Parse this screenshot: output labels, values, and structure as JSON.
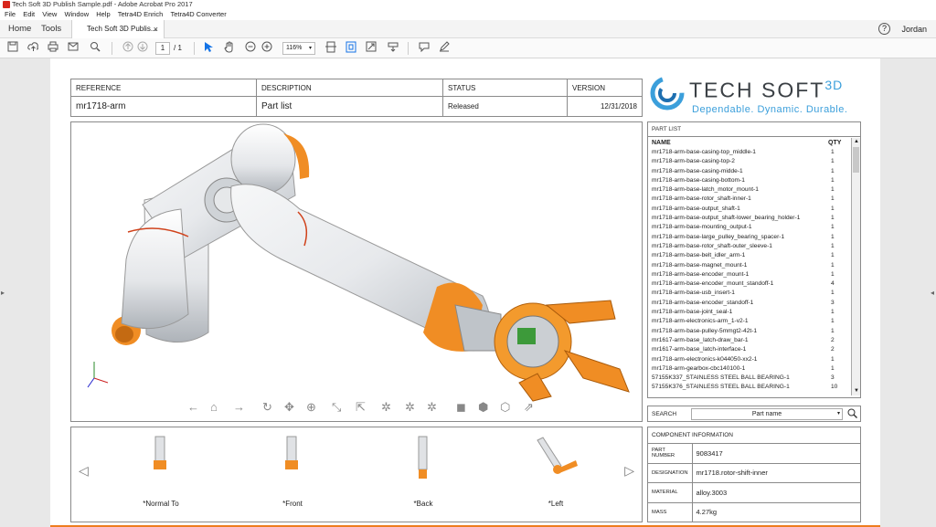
{
  "window": {
    "title": "Tech Soft 3D Publish Sample.pdf - Adobe Acrobat Pro 2017"
  },
  "menu": [
    "File",
    "Edit",
    "View",
    "Window",
    "Help",
    "Tetra4D Enrich",
    "Tetra4D Converter"
  ],
  "nav": {
    "home": "Home",
    "tools": "Tools",
    "doc_tab": "Tech Soft 3D Publis...",
    "close": "×",
    "help": "?",
    "user": "Jordan"
  },
  "toolbar": {
    "page_current": "1",
    "page_total": "/ 1",
    "zoom": "116%",
    "zoom_arrow": "▾"
  },
  "reference": {
    "headers": [
      "REFERENCE",
      "DESCRIPTION",
      "STATUS",
      "VERSION"
    ],
    "values": [
      "mr1718-arm",
      "Part list",
      "Released",
      "12/31/2018"
    ]
  },
  "logo": {
    "name": "TECH SOFT",
    "sup": "3D",
    "tagline": "Dependable. Dynamic. Durable."
  },
  "part_list": {
    "title": "PART LIST",
    "col_name": "NAME",
    "col_qty": "QTY",
    "rows": [
      {
        "name": "mr1718-arm-base-casing-top_middle-1",
        "qty": "1"
      },
      {
        "name": "mr1718-arm-base-casing-top-2",
        "qty": "1"
      },
      {
        "name": "mr1718-arm-base-casing-midde-1",
        "qty": "1"
      },
      {
        "name": "mr1718-arm-base-casing-bottom-1",
        "qty": "1"
      },
      {
        "name": "mr1718-arm-base-latch_motor_mount-1",
        "qty": "1"
      },
      {
        "name": "mr1718-arm-base-rotor_shaft-inner-1",
        "qty": "1"
      },
      {
        "name": "mr1718-arm-base-output_shaft-1",
        "qty": "1"
      },
      {
        "name": "mr1718-arm-base-output_shaft-lower_bearing_holder-1",
        "qty": "1"
      },
      {
        "name": "mr1718-arm-base-mounting_output-1",
        "qty": "1"
      },
      {
        "name": "mr1718-arm-base-large_pulley_bearing_spacer-1",
        "qty": "1"
      },
      {
        "name": "mr1718-arm-base-rotor_shaft-outer_sleeve-1",
        "qty": "1"
      },
      {
        "name": "mr1718-arm-base-belt_idler_arm-1",
        "qty": "1"
      },
      {
        "name": "mr1718-arm-base-magnet_mount-1",
        "qty": "1"
      },
      {
        "name": "mr1718-arm-base-encoder_mount-1",
        "qty": "1"
      },
      {
        "name": "mr1718-arm-base-encoder_mount_standoff-1",
        "qty": "4"
      },
      {
        "name": "mr1718-arm-base-usb_insert-1",
        "qty": "1"
      },
      {
        "name": "mr1718-arm-base-encoder_standoff-1",
        "qty": "3"
      },
      {
        "name": "mr1718-arm-base-joint_seal-1",
        "qty": "1"
      },
      {
        "name": "mr1718-arm-electronics-arm_1-v2-1",
        "qty": "1"
      },
      {
        "name": "mr1718-arm-base-pulley-5mmgt2-42t-1",
        "qty": "1"
      },
      {
        "name": "mr1617-arm-base_latch-draw_bar-1",
        "qty": "2"
      },
      {
        "name": "mr1617-arm-base_latch-interface-1",
        "qty": "2"
      },
      {
        "name": "mr1718-arm-electronics-k044050-xx2-1",
        "qty": "1"
      },
      {
        "name": "mr1718-arm-gearbox-cbc140100-1",
        "qty": "1"
      },
      {
        "name": "57155K337_STAINLESS STEEL BALL BEARING-1",
        "qty": "3"
      },
      {
        "name": "57155K376_STAINLESS STEEL BALL BEARING-1",
        "qty": "10"
      }
    ]
  },
  "search": {
    "label": "SEARCH",
    "field": "Part name",
    "arrow": "▾"
  },
  "component_info": {
    "title": "COMPONENT INFORMATION",
    "rows": [
      {
        "key": "PART NUMBER",
        "value": "9083417"
      },
      {
        "key": "DESIGNATION",
        "value": "mr1718.rotor-shift-inner"
      },
      {
        "key": "MATERIAL",
        "value": "alloy.3003"
      },
      {
        "key": "MASS",
        "value": "4.27kg"
      }
    ]
  },
  "views": [
    "*Normal To",
    "*Front",
    "*Back",
    "*Left"
  ],
  "colors": {
    "accent_orange": "#ee7d1f",
    "logo_blue": "#3b9fdb",
    "acrobat_red": "#d8261c"
  },
  "icons": [
    "save-icon",
    "upload-icon",
    "print-icon",
    "mail-icon",
    "search-icon",
    "page-up-icon",
    "page-down-icon",
    "select-cursor-icon",
    "hand-icon",
    "zoom-out-icon",
    "zoom-in-icon",
    "fit-icon",
    "comment-icon",
    "pen-icon"
  ]
}
